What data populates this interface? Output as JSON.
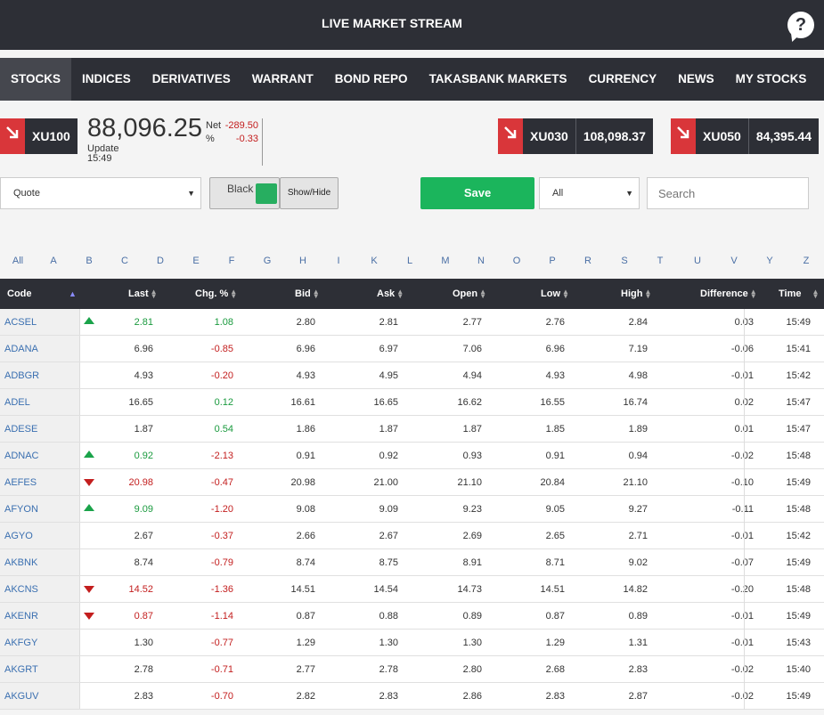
{
  "header": {
    "title": "LIVE MARKET STREAM",
    "help_icon": "?"
  },
  "nav": [
    "STOCKS",
    "INDICES",
    "DERIVATIVES",
    "WARRANT",
    "BOND REPO",
    "TAKASBANK MARKETS",
    "CURRENCY",
    "NEWS",
    "MY STOCKS"
  ],
  "xu100": {
    "name": "XU100",
    "value": "88,096.25",
    "net_label": "Net",
    "pct_label": "%",
    "net": "-289.50",
    "pct": "-0.33",
    "update_label": "Update",
    "update_time": "15:49"
  },
  "xu030": {
    "name": "XU030",
    "value": "108,098.37"
  },
  "xu050": {
    "name": "XU050",
    "value": "84,395.44"
  },
  "controls": {
    "quote": "Quote",
    "theme_label": "Black",
    "show_hide": "Show/Hide",
    "save": "Save",
    "filter": "All",
    "search_placeholder": "Search"
  },
  "letters": [
    "All",
    "A",
    "B",
    "C",
    "D",
    "E",
    "F",
    "G",
    "H",
    "I",
    "K",
    "L",
    "M",
    "N",
    "O",
    "P",
    "R",
    "S",
    "T",
    "U",
    "V",
    "Y",
    "Z"
  ],
  "columns": {
    "code": "Code",
    "last": "Last",
    "chg": "Chg. %",
    "bid": "Bid",
    "ask": "Ask",
    "open": "Open",
    "low": "Low",
    "high": "High",
    "diff": "Difference",
    "time": "Time"
  },
  "rows": [
    {
      "code": "ACSEL",
      "dir": "up",
      "last": "2.81",
      "chg": "1.08",
      "bid": "2.80",
      "ask": "2.81",
      "open": "2.77",
      "low": "2.76",
      "high": "2.84",
      "diff": "0.03",
      "time": "15:49"
    },
    {
      "code": "ADANA",
      "dir": "",
      "last": "6.96",
      "chg": "-0.85",
      "bid": "6.96",
      "ask": "6.97",
      "open": "7.06",
      "low": "6.96",
      "high": "7.19",
      "diff": "-0.06",
      "time": "15:41"
    },
    {
      "code": "ADBGR",
      "dir": "",
      "last": "4.93",
      "chg": "-0.20",
      "bid": "4.93",
      "ask": "4.95",
      "open": "4.94",
      "low": "4.93",
      "high": "4.98",
      "diff": "-0.01",
      "time": "15:42"
    },
    {
      "code": "ADEL",
      "dir": "",
      "last": "16.65",
      "chg": "0.12",
      "bid": "16.61",
      "ask": "16.65",
      "open": "16.62",
      "low": "16.55",
      "high": "16.74",
      "diff": "0.02",
      "time": "15:47"
    },
    {
      "code": "ADESE",
      "dir": "",
      "last": "1.87",
      "chg": "0.54",
      "bid": "1.86",
      "ask": "1.87",
      "open": "1.87",
      "low": "1.85",
      "high": "1.89",
      "diff": "0.01",
      "time": "15:47"
    },
    {
      "code": "ADNAC",
      "dir": "up",
      "last": "0.92",
      "chg": "-2.13",
      "bid": "0.91",
      "ask": "0.92",
      "open": "0.93",
      "low": "0.91",
      "high": "0.94",
      "diff": "-0.02",
      "time": "15:48"
    },
    {
      "code": "AEFES",
      "dir": "down",
      "last": "20.98",
      "chg": "-0.47",
      "bid": "20.98",
      "ask": "21.00",
      "open": "21.10",
      "low": "20.84",
      "high": "21.10",
      "diff": "-0.10",
      "time": "15:49"
    },
    {
      "code": "AFYON",
      "dir": "up",
      "last": "9.09",
      "chg": "-1.20",
      "bid": "9.08",
      "ask": "9.09",
      "open": "9.23",
      "low": "9.05",
      "high": "9.27",
      "diff": "-0.11",
      "time": "15:48"
    },
    {
      "code": "AGYO",
      "dir": "",
      "last": "2.67",
      "chg": "-0.37",
      "bid": "2.66",
      "ask": "2.67",
      "open": "2.69",
      "low": "2.65",
      "high": "2.71",
      "diff": "-0.01",
      "time": "15:42"
    },
    {
      "code": "AKBNK",
      "dir": "",
      "last": "8.74",
      "chg": "-0.79",
      "bid": "8.74",
      "ask": "8.75",
      "open": "8.91",
      "low": "8.71",
      "high": "9.02",
      "diff": "-0.07",
      "time": "15:49"
    },
    {
      "code": "AKCNS",
      "dir": "down",
      "last": "14.52",
      "chg": "-1.36",
      "bid": "14.51",
      "ask": "14.54",
      "open": "14.73",
      "low": "14.51",
      "high": "14.82",
      "diff": "-0.20",
      "time": "15:48"
    },
    {
      "code": "AKENR",
      "dir": "down",
      "last": "0.87",
      "chg": "-1.14",
      "bid": "0.87",
      "ask": "0.88",
      "open": "0.89",
      "low": "0.87",
      "high": "0.89",
      "diff": "-0.01",
      "time": "15:49"
    },
    {
      "code": "AKFGY",
      "dir": "",
      "last": "1.30",
      "chg": "-0.77",
      "bid": "1.29",
      "ask": "1.30",
      "open": "1.30",
      "low": "1.29",
      "high": "1.31",
      "diff": "-0.01",
      "time": "15:43"
    },
    {
      "code": "AKGRT",
      "dir": "",
      "last": "2.78",
      "chg": "-0.71",
      "bid": "2.77",
      "ask": "2.78",
      "open": "2.80",
      "low": "2.68",
      "high": "2.83",
      "diff": "-0.02",
      "time": "15:40"
    },
    {
      "code": "AKGUV",
      "dir": "",
      "last": "2.83",
      "chg": "-0.70",
      "bid": "2.82",
      "ask": "2.83",
      "open": "2.86",
      "low": "2.83",
      "high": "2.87",
      "diff": "-0.02",
      "time": "15:49"
    }
  ]
}
